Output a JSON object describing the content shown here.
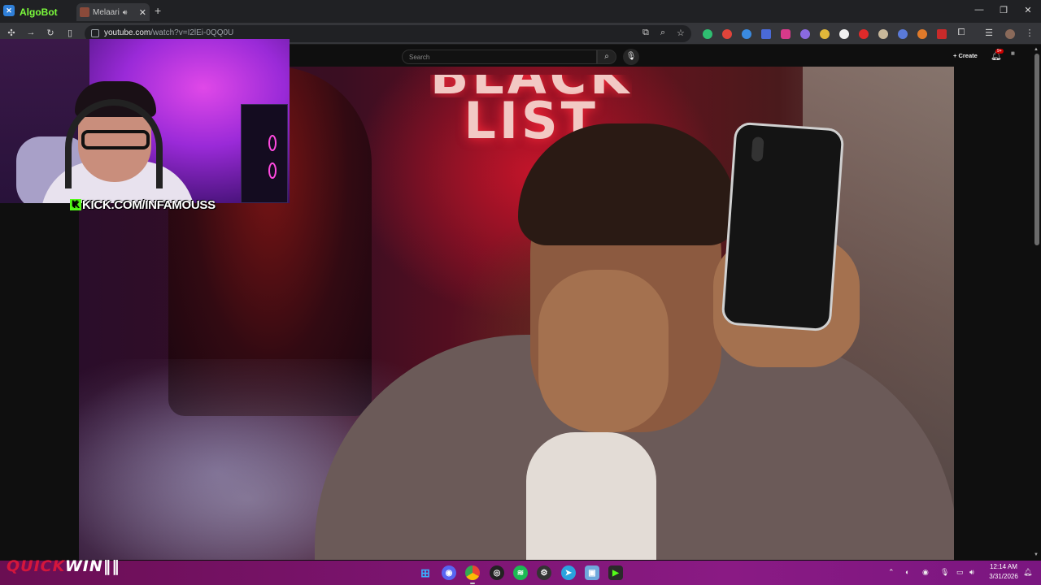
{
  "browser": {
    "tabs": [
      {
        "label": "AlgoBot"
      },
      {
        "label": "Melaari"
      }
    ],
    "url_host": "youtube.com",
    "url_path": "/watch?v=I2lEi-0QQ0U"
  },
  "youtube": {
    "search_placeholder": "Search",
    "create_label": "Create",
    "notification_count": "9+"
  },
  "video": {
    "thumbnail_text_line1": "BLACK",
    "thumbnail_text_line2": "LIST"
  },
  "overlay": {
    "kick_url": "KICK.COM/INFAMOUSS",
    "brand_part1": "QUICK",
    "brand_part2": "WIN"
  },
  "taskbar": {
    "time": "12:14 AM",
    "date": "3/31/2026"
  },
  "colors": {
    "kick_green": "#53fc18",
    "taskbar_purple": "#7c1470",
    "quickwin_red": "#d4163c"
  }
}
